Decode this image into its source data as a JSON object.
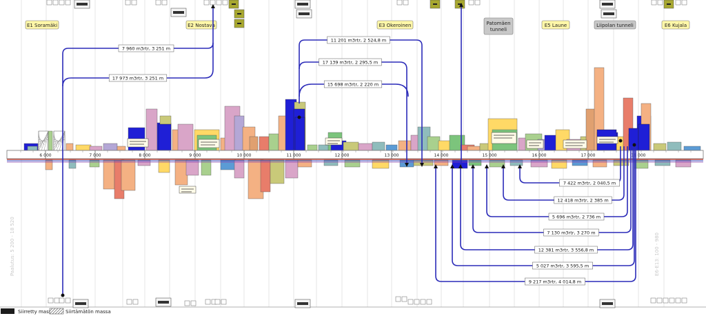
{
  "zones": [
    {
      "id": "E1",
      "label": "E1 Soramäki",
      "style": "yellow"
    },
    {
      "id": "E2",
      "label": "E2 Nostava",
      "style": "yellow"
    },
    {
      "id": "E3",
      "label": "E3 Okeroinen",
      "style": "yellow"
    },
    {
      "id": "PT",
      "label": "Patomäen tunneli",
      "style": "grey"
    },
    {
      "id": "E5",
      "label": "E5 Laune",
      "style": "yellow"
    },
    {
      "id": "LT",
      "label": "Liipolan tunneli",
      "style": "grey"
    },
    {
      "id": "E6",
      "label": "E6 Kujala",
      "style": "yellow"
    }
  ],
  "stations": [
    "6 000",
    "7 000",
    "8 000",
    "9 000",
    "10 000",
    "11 000",
    "12 000",
    "13 000",
    "14 000",
    "15 000",
    "16 000",
    "17 000",
    "18 000"
  ],
  "upper_transfers": [
    {
      "label": "7 960 m3rtr, 3 251 m"
    },
    {
      "label": "17 973 m3rtr, 3 251 m"
    },
    {
      "label": "11 201 m3rtr, 2 524,8 m"
    },
    {
      "label": "17 139 m3rtr, 2 295,5 m"
    },
    {
      "label": "15 698 m3rtr, 2 220 m"
    }
  ],
  "lower_transfers": [
    {
      "label": "7 422 m3rtr, 2 040,5 m"
    },
    {
      "label": "12 418 m3rtr, 2 385 m"
    },
    {
      "label": "5 696 m3rtr, 2 736 m"
    },
    {
      "label": "7 130 m3rtr, 3 270 m"
    },
    {
      "label": "12 381 m3rtr, 3 556,8 m"
    },
    {
      "label": "5 027 m3rtr, 3 595,5 m"
    },
    {
      "label": "9 217 m3rtr, 4 014,8 m"
    }
  ],
  "side_labels": {
    "left": "Paalutus: 5 200 - 18 520",
    "right": "E6-E13: 100 - 980"
  },
  "legend": {
    "moved": "Siirretty massa",
    "unmoved": "Siirtämätön massa"
  },
  "colors": {
    "moved_dark": "#1c1c1c",
    "transfer_line": "#2a2ab8",
    "zone_yellow": "#fff7a8",
    "zone_grey": "#c8c8c8",
    "fill_blue": "#1f1fd6",
    "axis_red": "#c0392b"
  }
}
